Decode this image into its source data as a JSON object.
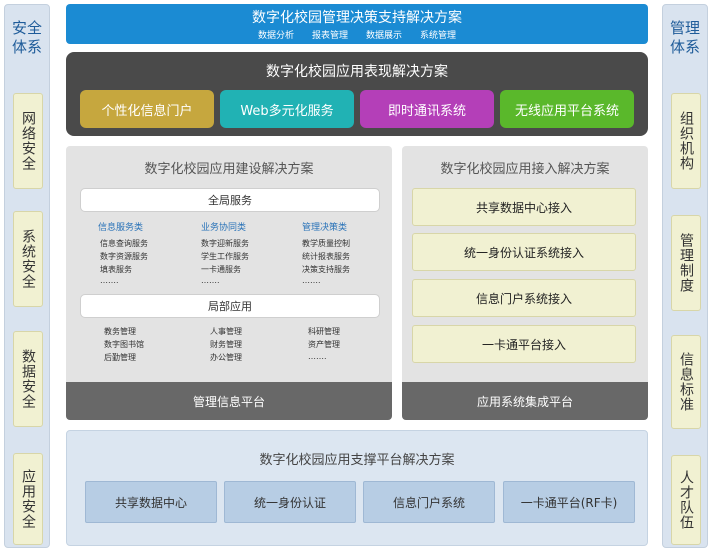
{
  "security_system": {
    "title": "安全体系",
    "items": [
      "网络安全",
      "系统安全",
      "数据安全",
      "应用安全"
    ]
  },
  "management_system": {
    "title": "管理体系",
    "items": [
      "组织机构",
      "管理制度",
      "信息标准",
      "人才队伍"
    ]
  },
  "decision_layer": {
    "title": "数字化校园管理决策支持解决方案",
    "subs": [
      "数据分析",
      "报表管理",
      "数据展示",
      "系统管理"
    ]
  },
  "presentation_layer": {
    "title": "数字化校园应用表现解决方案",
    "boxes": [
      "个性化信息门户",
      "Web多元化服务",
      "即时通讯系统",
      "无线应用平台系统"
    ],
    "colors": [
      "#c6a73e",
      "#21b2b4",
      "#b43fb8",
      "#5ab82b"
    ]
  },
  "build_layer": {
    "title": "数字化校园应用建设解决方案",
    "global_service": "全局服务",
    "categories": [
      {
        "title": "信息服务类",
        "items": [
          "信息查询服务",
          "数字资源服务",
          "填表服务",
          "……."
        ]
      },
      {
        "title": "业务协同类",
        "items": [
          "数字迎新服务",
          "学生工作服务",
          "一卡通服务",
          "……."
        ]
      },
      {
        "title": "管理决策类",
        "items": [
          "教学质量控制",
          "统计报表服务",
          "决策支持服务",
          "……."
        ]
      }
    ],
    "local_app": "局部应用",
    "local_columns": [
      [
        "教务管理",
        "数字图书馆",
        "后勤管理"
      ],
      [
        "人事管理",
        "财务管理",
        "办公管理"
      ],
      [
        "科研管理",
        "资产管理",
        "……."
      ]
    ],
    "platform": "管理信息平台"
  },
  "access_layer": {
    "title": "数字化校园应用接入解决方案",
    "items": [
      "共享数据中心接入",
      "统一身份认证系统接入",
      "信息门户系统接入",
      "一卡通平台接入"
    ],
    "platform": "应用系统集成平台"
  },
  "support_layer": {
    "title": "数字化校园应用支撑平台解决方案",
    "items": [
      "共享数据中心",
      "统一身份认证",
      "信息门户系统",
      "一卡通平台(RF卡)"
    ]
  }
}
